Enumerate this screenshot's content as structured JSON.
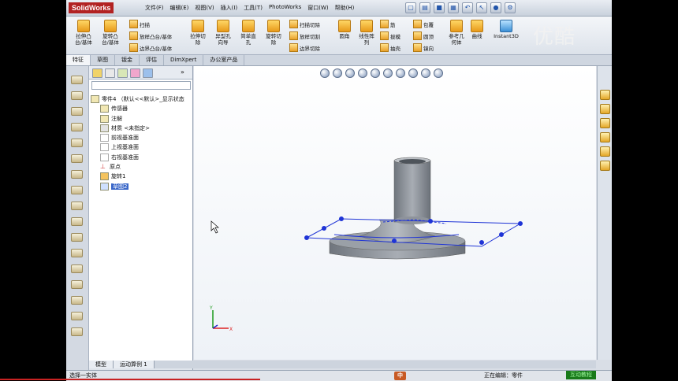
{
  "app": {
    "logo": "SolidWorks"
  },
  "menus": [
    "文件(F)",
    "编辑(E)",
    "视图(V)",
    "插入(I)",
    "工具(T)",
    "PhotoWorks",
    "窗口(W)",
    "帮助(H)"
  ],
  "ribbon": {
    "big_tools": [
      {
        "label": "拉伸凸\n台/基体"
      },
      {
        "label": "旋转凸\n台/基体"
      },
      {
        "label": "拉伸切\n除"
      },
      {
        "label": "异型孔\n向导"
      },
      {
        "label": "简单直\n孔"
      },
      {
        "label": "旋转切\n除"
      },
      {
        "label": "圆角"
      },
      {
        "label": "线性阵\n列"
      },
      {
        "label": "参考几\n何体"
      },
      {
        "label": "曲线"
      },
      {
        "label": "Instant3D"
      }
    ],
    "small_tools": [
      "扫描",
      "放样凸台/基体",
      "边界凸台/基体",
      "扫描切除",
      "放样切割",
      "边界切除",
      "筋",
      "拔模",
      "抽壳",
      "包覆",
      "圆顶",
      "镜向"
    ]
  },
  "command_tabs": [
    "特征",
    "草图",
    "钣金",
    "评估",
    "DimXpert",
    "办公室产品"
  ],
  "tree": {
    "root": "零件4 （默认<<默认>_显示状态",
    "items": [
      "传感器",
      "注解",
      "材质 <未指定>",
      "前视基准面",
      "上视基准面",
      "右视基准面",
      "原点",
      "旋转1",
      "草图2"
    ]
  },
  "bottom_tabs": [
    "模型",
    "运动算例 1"
  ],
  "status": {
    "left": "选择一实体",
    "right": "正在编辑：零件",
    "ime": "中",
    "green": "互动教程"
  },
  "watermark": "优酷",
  "triad": {
    "x_label": "X",
    "y_label": "Y"
  },
  "colors": {
    "part": "#8e939b",
    "sketch": "#1f34d6",
    "selection": "#3a67c9"
  }
}
